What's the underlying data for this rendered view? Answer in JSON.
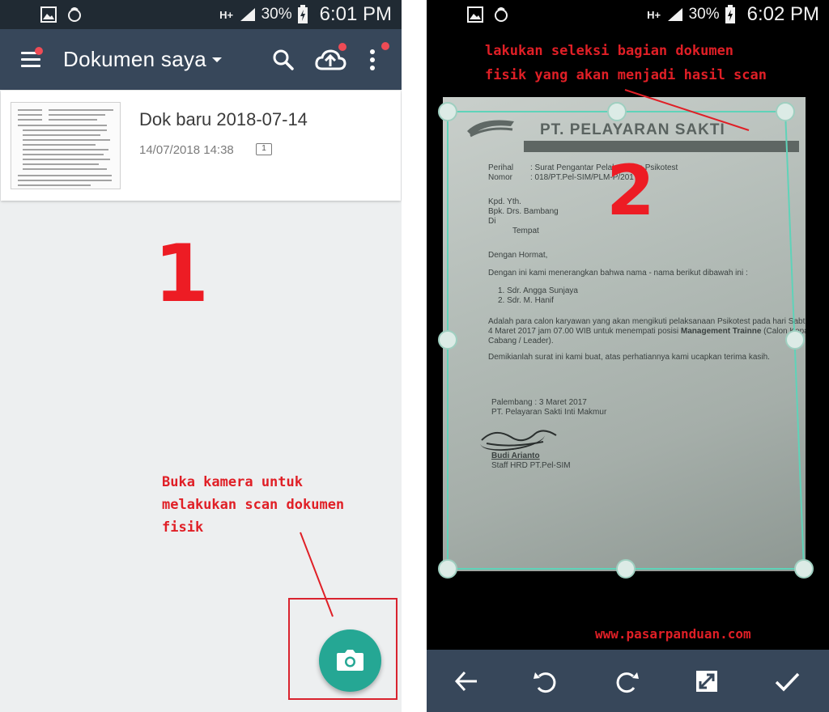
{
  "left_screen": {
    "status": {
      "network": "H+",
      "battery": "30%",
      "time": "6:01 PM"
    },
    "appbar": {
      "title": "Dokumen saya"
    },
    "document": {
      "name": "Dok baru 2018-07-14",
      "date": "14/07/2018 14:38",
      "pages": "1"
    },
    "step_number": "1",
    "annotation": [
      "Buka kamera untuk",
      "melakukan scan dokumen",
      "fisik"
    ],
    "icons": [
      "menu-icon",
      "caret-down-icon",
      "search-icon",
      "cloud-upload-icon",
      "more-vert-icon",
      "camera-icon"
    ],
    "colors": {
      "appbar": "#37475a",
      "fab": "#25a794",
      "badge": "#ef4b55",
      "annotation": "#e01f26"
    }
  },
  "right_screen": {
    "status": {
      "network": "H+",
      "battery": "30%",
      "time": "6:02 PM"
    },
    "annotation": [
      "lakukan seleksi bagian dokumen",
      "fisik yang akan menjadi hasil scan"
    ],
    "step_number": "2",
    "watermark": "www.pasarpanduan.com",
    "document_preview": {
      "header": "PT. PELAYARAN SAKTI",
      "perihal_label": "Perihal",
      "perihal_value": ": Surat Pengantar Pelaksanaan Psikotest",
      "nomor_label": "Nomor",
      "nomor_value": ": 018/PT.Pel-SIM/PLM-P/2017",
      "recipient": [
        "Kpd. Yth.",
        "Bpk. Drs. Bambang",
        "Di",
        "Tempat"
      ],
      "greeting": "Dengan Hormat,",
      "intro": "Dengan ini kami menerangkan bahwa nama - nama berikut dibawah ini :",
      "names": [
        "1.   Sdr. Angga Sunjaya",
        "2.   Sdr. M. Hanif"
      ],
      "body": [
        "Adalah para calon karyawan yang akan mengikuti pelaksanaan Psikotest pada hari Sabtu tanggal",
        "4 Maret 2017 jam 07.00 WIB untuk menempati posisi",
        "Cabang / Leader)."
      ],
      "body_bold": "Management Trainne",
      "body_tail": "(Calon Kepala",
      "closing": "Demikianlah surat ini kami buat, atas perhatiannya kami ucapkan terima kasih.",
      "place_date": "Palembang       : 3 Maret 2017",
      "company": "PT. Pelayaran Sakti Inti Makmur",
      "signer": "Budi Arianto",
      "signer_title": "Staff HRD PT.Pel-SIM"
    },
    "toolbar": [
      "back-arrow-icon",
      "rotate-left-icon",
      "rotate-right-icon",
      "expand-icon",
      "check-icon"
    ],
    "colors": {
      "crop_border": "#5fd3b9",
      "toolbar": "#37475a"
    }
  }
}
